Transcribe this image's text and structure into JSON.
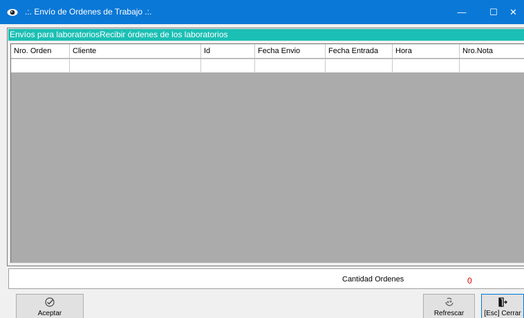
{
  "window": {
    "title": ".:. Envío de Ordenes de Trabajo .:.",
    "accent": "#0a78d7"
  },
  "tabs": {
    "items": [
      "Envíos para laboratorios",
      "Recibir órdenes de los laboratorios"
    ],
    "color": "#1cbfb4"
  },
  "grid": {
    "columns": [
      "Nro. Orden",
      "Cliente",
      "Id",
      "Fecha Envio",
      "Fecha Entrada",
      "Hora",
      "Nro.Nota"
    ],
    "rows": [
      [
        "",
        "",
        "",
        "",
        "",
        "",
        ""
      ]
    ]
  },
  "footer": {
    "count_label": "Cantidad Ordenes",
    "count_value": "0"
  },
  "buttons": {
    "aceptar": "Aceptar",
    "refrescar": "Refrescar",
    "cerrar": "[Esc] Cerrar"
  },
  "icons": {
    "app": "eye-icon",
    "aceptar": "check-circle-icon",
    "refrescar": "refresh-icon",
    "cerrar": "exit-door-icon"
  }
}
